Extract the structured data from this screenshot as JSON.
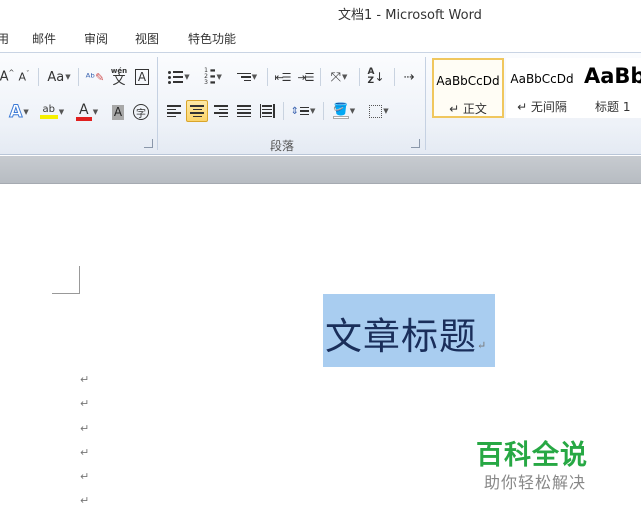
{
  "window": {
    "title": "文档1  -  Microsoft Word"
  },
  "tabs": [
    "用",
    "邮件",
    "审阅",
    "视图",
    "特色功能"
  ],
  "ribbon": {
    "font_group": {
      "grow_font": "A",
      "shrink_font": "A",
      "change_case": "Aa",
      "phonetic_guide": "wén",
      "phonetic_char": "文",
      "char_border": "A",
      "text_effects": "A",
      "highlight": "ab",
      "font_color": "A",
      "char_shading": "A",
      "enclose_char": "字"
    },
    "paragraph_group": {
      "label": "段落",
      "sort": "A↓Z",
      "chinese_layout": "⇢"
    },
    "styles": [
      {
        "sample": "AaBbCcDd",
        "name": "↵ 正文",
        "selected": true
      },
      {
        "sample": "AaBbCcDd",
        "name": "↵ 无间隔",
        "selected": false
      },
      {
        "sample": "AaBb",
        "name": "标题 1",
        "selected": false
      }
    ]
  },
  "document": {
    "title_text": "文章标题",
    "paragraph_mark": "↵"
  },
  "watermark": {
    "main": "百科全说",
    "sub": "助你轻松解决"
  }
}
